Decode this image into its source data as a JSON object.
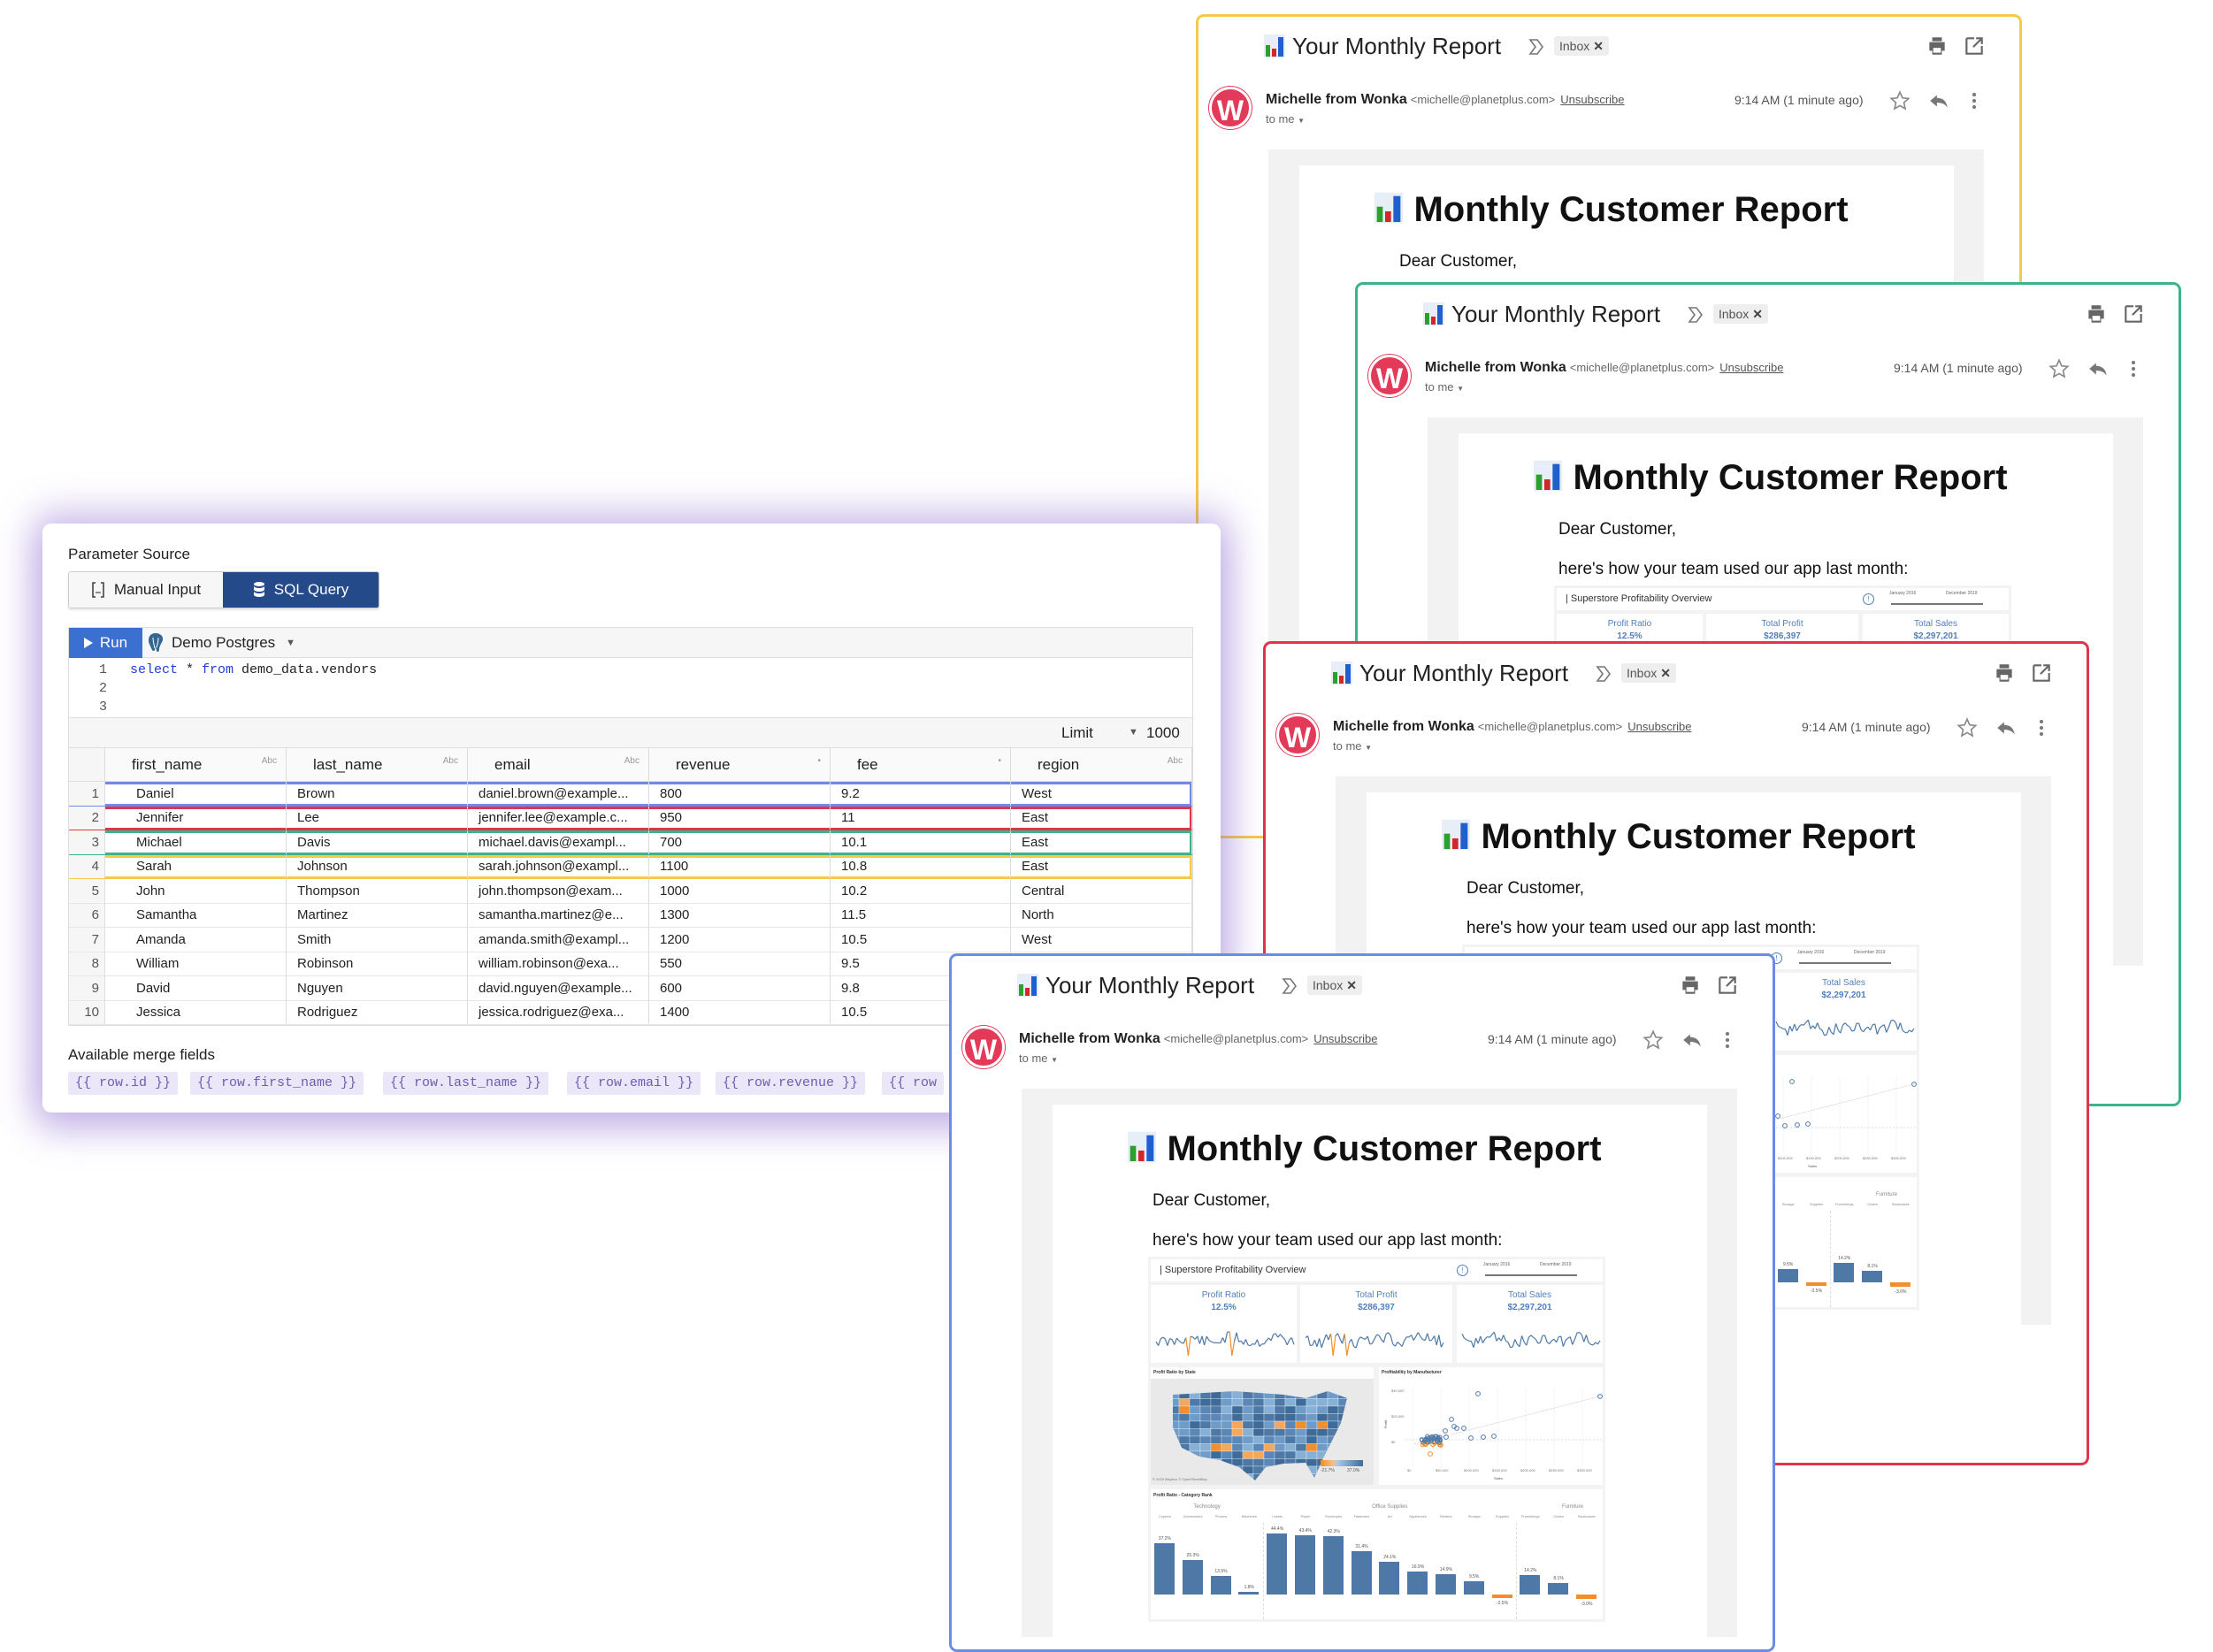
{
  "panel": {
    "section_label": "Parameter Source",
    "tabs": [
      {
        "label": "Manual Input",
        "active": false
      },
      {
        "label": "SQL Query",
        "active": true
      }
    ],
    "run_label": "Run",
    "datasource": "Demo Postgres",
    "code_lines": [
      [
        {
          "t": "select",
          "kw": true
        },
        {
          "t": " * ",
          "kw": false
        },
        {
          "t": "from",
          "kw": true
        },
        {
          "t": " demo_data.vendors",
          "kw": false
        }
      ],
      [],
      []
    ],
    "limit_label": "Limit",
    "limit_value": "1000",
    "columns": [
      {
        "name": "first_name",
        "type": "Abc"
      },
      {
        "name": "last_name",
        "type": "Abc"
      },
      {
        "name": "email",
        "type": "Abc"
      },
      {
        "name": "revenue",
        "type": "•"
      },
      {
        "name": "fee",
        "type": "•"
      },
      {
        "name": "region",
        "type": "Abc"
      }
    ],
    "rows": [
      [
        "1",
        "Daniel",
        "Brown",
        "daniel.brown@example...",
        "800",
        "9.2",
        "West"
      ],
      [
        "2",
        "Jennifer",
        "Lee",
        "jennifer.lee@example.c...",
        "950",
        "11",
        "East"
      ],
      [
        "3",
        "Michael",
        "Davis",
        "michael.davis@exampl...",
        "700",
        "10.1",
        "East"
      ],
      [
        "4",
        "Sarah",
        "Johnson",
        "sarah.johnson@exampl...",
        "1100",
        "10.8",
        "East"
      ],
      [
        "5",
        "John",
        "Thompson",
        "john.thompson@exam...",
        "1000",
        "10.2",
        "Central"
      ],
      [
        "6",
        "Samantha",
        "Martinez",
        "samantha.martinez@e...",
        "1300",
        "11.5",
        "North"
      ],
      [
        "7",
        "Amanda",
        "Smith",
        "amanda.smith@exampl...",
        "1200",
        "10.5",
        "West"
      ],
      [
        "8",
        "William",
        "Robinson",
        "william.robinson@exa...",
        "550",
        "9.5",
        "West"
      ],
      [
        "9",
        "David",
        "Nguyen",
        "david.nguyen@example...",
        "600",
        "9.8",
        "East"
      ],
      [
        "10",
        "Jessica",
        "Rodriguez",
        "jessica.rodriguez@exa...",
        "1400",
        "10.5",
        "West"
      ]
    ],
    "row_highlights": [
      "#6c8ae6",
      "#e0364b",
      "#3db38a",
      "#f6c94a"
    ],
    "merge_fields_label": "Available merge fields",
    "merge_fields": [
      "{{ row.id }}",
      "{{ row.first_name }}",
      "{{ row.last_name }}",
      "{{ row.email }}",
      "{{ row.revenue }}",
      "{{ row"
    ]
  },
  "email": {
    "subject": "Your Monthly Report",
    "label": "Inbox",
    "avatar_letter": "W",
    "sender_name": "Michelle from Wonka",
    "sender_email": "<michelle@planetplus.com>",
    "unsubscribe": "Unsubscribe",
    "recipient": "to me",
    "time": "9:14 AM (1 minute ago)",
    "heading": "Monthly Customer Report",
    "greeting": "Dear Customer,",
    "intro": "here's how your team used our app last month:",
    "dashboard": {
      "title": "Superstore Profitability Overview",
      "date_start": "January 2016",
      "date_end": "December 2019",
      "kpis": [
        {
          "label": "Profit Ratio",
          "value": "12.5%"
        },
        {
          "label": "Total Profit",
          "value": "$286,397"
        },
        {
          "label": "Total Sales",
          "value": "$2,297,201"
        }
      ],
      "map_title": "Profit Ratio by State",
      "map_legend_min": "-21.7%",
      "map_legend_max": "37.0%",
      "map_credit": "© 2020 Mapbox © OpenStreetMap",
      "scatter_title": "Profitability by Manufacturer",
      "scatter_y_ticks": [
        "$40,000",
        "$20,000",
        "$0"
      ],
      "scatter_x_ticks": [
        "$0",
        "$50,000",
        "$100,000",
        "$150,000",
        "$200,000",
        "$250,000",
        "$300,000"
      ],
      "scatter_ylabel": "Profit",
      "scatter_xlabel": "Sales",
      "bar_title": "Profit Ratio - Category Rank",
      "categories": [
        {
          "name": "Technology",
          "subs": [
            [
              "Copiers",
              37.2
            ],
            [
              "Accessories",
              25.3
            ],
            [
              "Phones",
              13.5
            ],
            [
              "Machines",
              1.8
            ]
          ]
        },
        {
          "name": "Office Supplies",
          "subs": [
            [
              "Labels",
              44.4
            ],
            [
              "Paper",
              43.4
            ],
            [
              "Envelopes",
              42.3
            ],
            [
              "Fasteners",
              31.4
            ],
            [
              "Art",
              24.1
            ],
            [
              "Appliances",
              16.9
            ],
            [
              "Binders",
              14.9
            ],
            [
              "Storage",
              9.5
            ],
            [
              "Supplies",
              -2.5
            ]
          ]
        },
        {
          "name": "Furniture",
          "subs": [
            [
              "Furnishings",
              14.2
            ],
            [
              "Chairs",
              8.1
            ],
            [
              "Bookcases",
              -3.0
            ],
            [
              "Tables",
              -8.6
            ]
          ]
        }
      ],
      "colors": {
        "positive": "#4e79a7",
        "negative": "#f28e2b",
        "kpi_text": "#4f7fbf"
      }
    }
  },
  "cards": [
    {
      "accent": "#f6c94a"
    },
    {
      "accent": "#3db38a"
    },
    {
      "accent": "#e0364b"
    },
    {
      "accent": "#6c8ae6"
    }
  ],
  "colors": {
    "sql_tab": "#254a8a",
    "run_button": "#3b6fd0",
    "avatar": "#e23a58",
    "merge_chip_bg": "#ebe6f8"
  }
}
